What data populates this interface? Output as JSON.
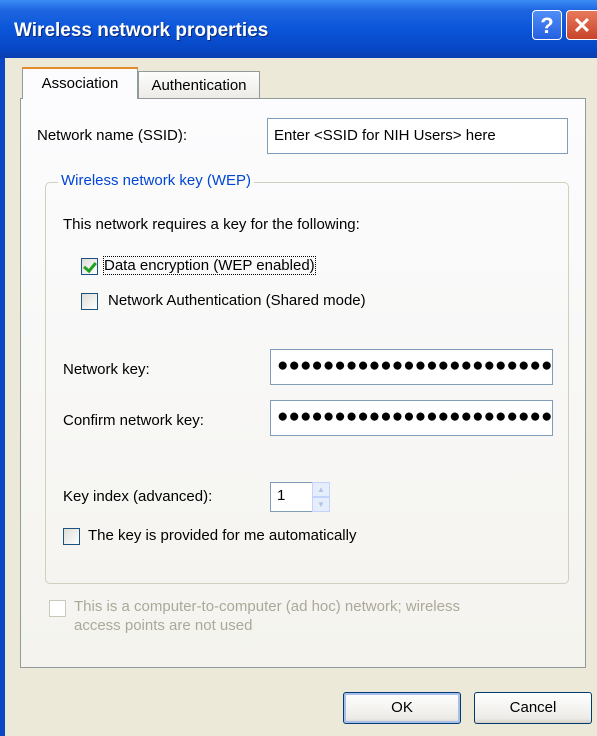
{
  "window": {
    "title": "Wireless network properties",
    "help_glyph": "?",
    "close_glyph": "✕"
  },
  "tabs": [
    {
      "label": "Association"
    },
    {
      "label": "Authentication"
    }
  ],
  "association": {
    "ssid_label": "Network name (SSID):",
    "ssid_value": "Enter <SSID for NIH Users> here",
    "wep_group_title": "Wireless network key (WEP)",
    "requires_text": "This network requires a key for the following:",
    "data_encryption_label": "Data encryption (WEP enabled)",
    "data_encryption_checked": true,
    "network_auth_label": "Network Authentication (Shared mode)",
    "network_auth_checked": false,
    "network_key_label": "Network key:",
    "network_key_value": "●●●●●●●●●●●●●●●●●●●●●●●●●●",
    "confirm_key_label": "Confirm network key:",
    "confirm_key_value": "●●●●●●●●●●●●●●●●●●●●●●●●●●",
    "key_index_label": "Key index (advanced):",
    "key_index_value": "1",
    "auto_key_label": "The key is provided for me automatically",
    "auto_key_checked": false,
    "adhoc_label_line1": "This is a computer-to-computer (ad hoc) network; wireless",
    "adhoc_label_line2": "access points are not used",
    "adhoc_checked": false
  },
  "buttons": {
    "ok": "OK",
    "cancel": "Cancel"
  }
}
